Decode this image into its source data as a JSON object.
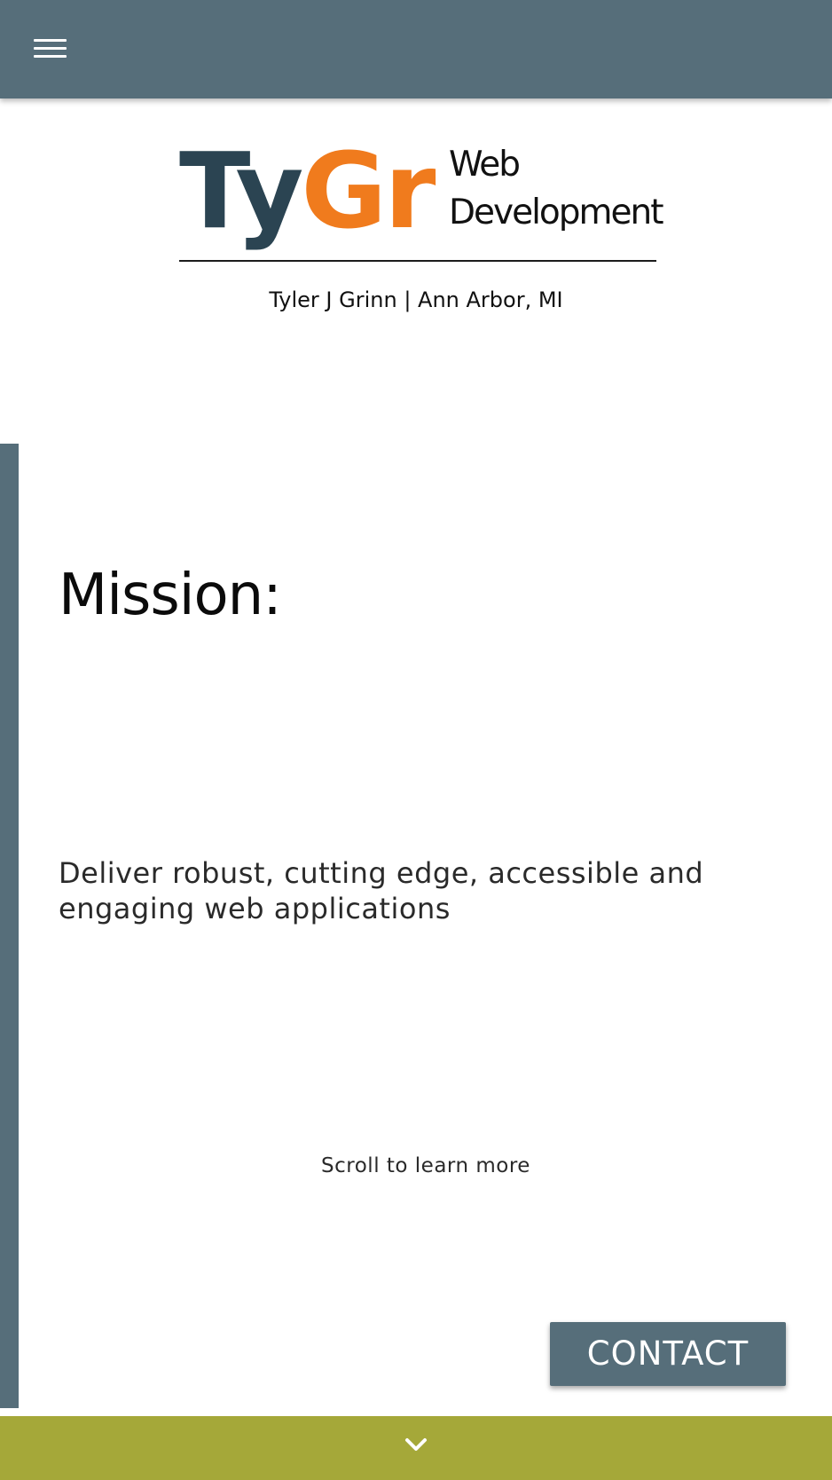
{
  "header": {
    "menu_icon": "hamburger-menu-icon",
    "background_color": "#566e7a"
  },
  "logo": {
    "ty": "Ty",
    "gr": "Gr",
    "tagline_line1": "Web",
    "tagline_line2": "Development",
    "ty_color": "#2b4452",
    "gr_color": "#f07b1d"
  },
  "byline": "Tyler J Grinn | Ann Arbor, MI",
  "mission": {
    "title": "Mission:",
    "text": "Deliver robust, cutting edge, accessible and engaging web applications"
  },
  "scroll_hint": "Scroll to learn more",
  "contact_button": {
    "label": "CONTACT",
    "color": "#566e7a"
  },
  "bottom_bar": {
    "icon": "chevron-down-icon",
    "color": "#a5a839"
  }
}
